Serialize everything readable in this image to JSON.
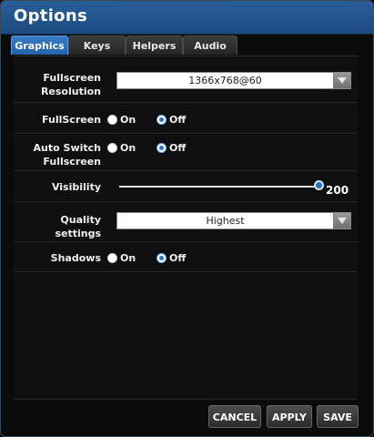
{
  "window": {
    "title": "Options"
  },
  "tabs": [
    {
      "label": "Graphics",
      "active": true
    },
    {
      "label": "Keys",
      "active": false
    },
    {
      "label": "Helpers",
      "active": false
    },
    {
      "label": "Audio",
      "active": false
    }
  ],
  "settings": {
    "resolution": {
      "label_line1": "Fullscreen",
      "label_line2": "Resolution",
      "value": "1366x768@60"
    },
    "fullscreen": {
      "label": "FullScreen",
      "on_label": "On",
      "off_label": "Off",
      "selected": "Off"
    },
    "auto_switch": {
      "label_line1": "Auto Switch",
      "label_line2": "Fullscreen",
      "on_label": "On",
      "off_label": "Off",
      "selected": "Off"
    },
    "visibility": {
      "label": "Visibility",
      "value": "200",
      "fraction": 1.0
    },
    "quality": {
      "label": "Quality settings",
      "value": "Highest"
    },
    "shadows": {
      "label": "Shadows",
      "on_label": "On",
      "off_label": "Off",
      "selected": "Off"
    }
  },
  "buttons": {
    "cancel": "CANCEL",
    "apply": "APPLY",
    "save": "SAVE"
  },
  "colors": {
    "accent": "#2a6fc0",
    "titlebar": "#2a5e9a"
  }
}
